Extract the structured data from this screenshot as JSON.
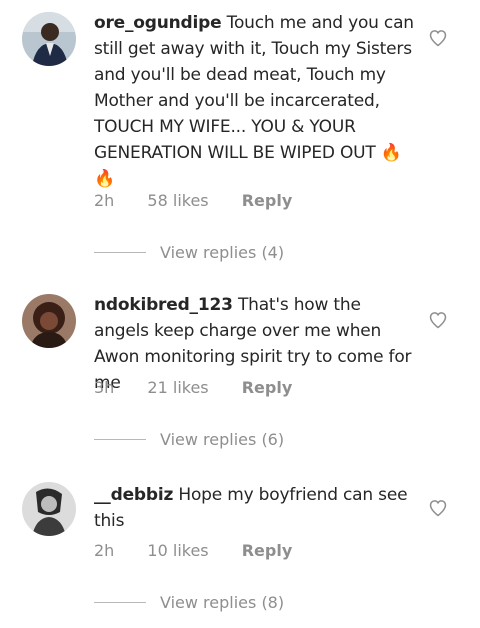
{
  "comments": [
    {
      "username": "ore_ogundipe",
      "text": "Touch me and you can still get away with it, Touch my Sisters and you'll be dead meat, Touch my Mother and you'll be incarcerated, TOUCH MY WIFE... YOU & YOUR GENERATION WILL BE WIPED OUT 🔥🔥",
      "time": "2h",
      "likes": "58 likes",
      "reply": "Reply",
      "view_replies": "View replies (4)",
      "avatar_icon": "profile-photo",
      "like_icon": "heart-outline-icon"
    },
    {
      "username": "ndokibred_123",
      "text": "That's how the angels keep charge over me when Awon monitoring spirit try to come for me",
      "time": "3h",
      "likes": "21 likes",
      "reply": "Reply",
      "view_replies": "View replies (6)",
      "avatar_icon": "profile-photo",
      "like_icon": "heart-outline-icon"
    },
    {
      "username": "__debbiz",
      "text": "Hope my boyfriend can see this",
      "time": "2h",
      "likes": "10 likes",
      "reply": "Reply",
      "view_replies": "View replies (8)",
      "avatar_icon": "profile-photo",
      "like_icon": "heart-outline-icon"
    }
  ]
}
